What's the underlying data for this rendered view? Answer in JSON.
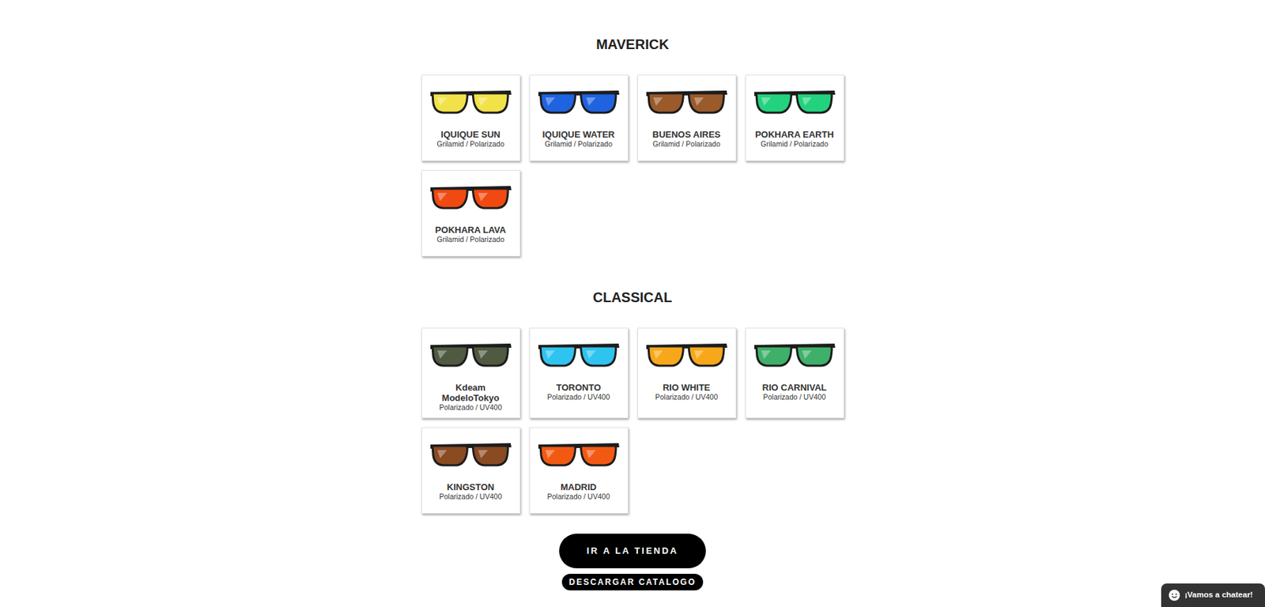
{
  "sections": [
    {
      "title": "MAVERICK",
      "products": [
        {
          "name": "IQUIQUE SUN",
          "spec": "Grilamid / Polarizado",
          "color": "#f2e24a"
        },
        {
          "name": "IQUIQUE WATER",
          "spec": "Grilamid / Polarizado",
          "color": "#1f63e0"
        },
        {
          "name": "BUENOS AIRES",
          "spec": "Grilamid / Polarizado",
          "color": "#9a5a2a"
        },
        {
          "name": "POKHARA EARTH",
          "spec": "Grilamid / Polarizado",
          "color": "#22d27e"
        },
        {
          "name": "POKHARA LAVA",
          "spec": "Grilamid / Polarizado",
          "color": "#f04a12"
        }
      ]
    },
    {
      "title": "CLASSICAL",
      "products": [
        {
          "name": "Kdeam ModeloTokyo",
          "spec": "Polarizado / UV400",
          "color": "#4f5a40"
        },
        {
          "name": "TORONTO",
          "spec": "Polarizado / UV400",
          "color": "#2fc4ef"
        },
        {
          "name": "RIO WHITE",
          "spec": "Polarizado / UV400",
          "color": "#f7a81a"
        },
        {
          "name": "RIO CARNIVAL",
          "spec": "Polarizado / UV400",
          "color": "#3fb06a"
        },
        {
          "name": "KINGSTON",
          "spec": "Polarizado / UV400",
          "color": "#8a4a22"
        },
        {
          "name": "MADRID",
          "spec": "Polarizado / UV400",
          "color": "#f25a14"
        }
      ]
    }
  ],
  "buttons": [
    "IR A LA TIENDA",
    "DESCARGAR CATALOGO"
  ],
  "chat": {
    "label": "¡Vamos a chatear!"
  }
}
